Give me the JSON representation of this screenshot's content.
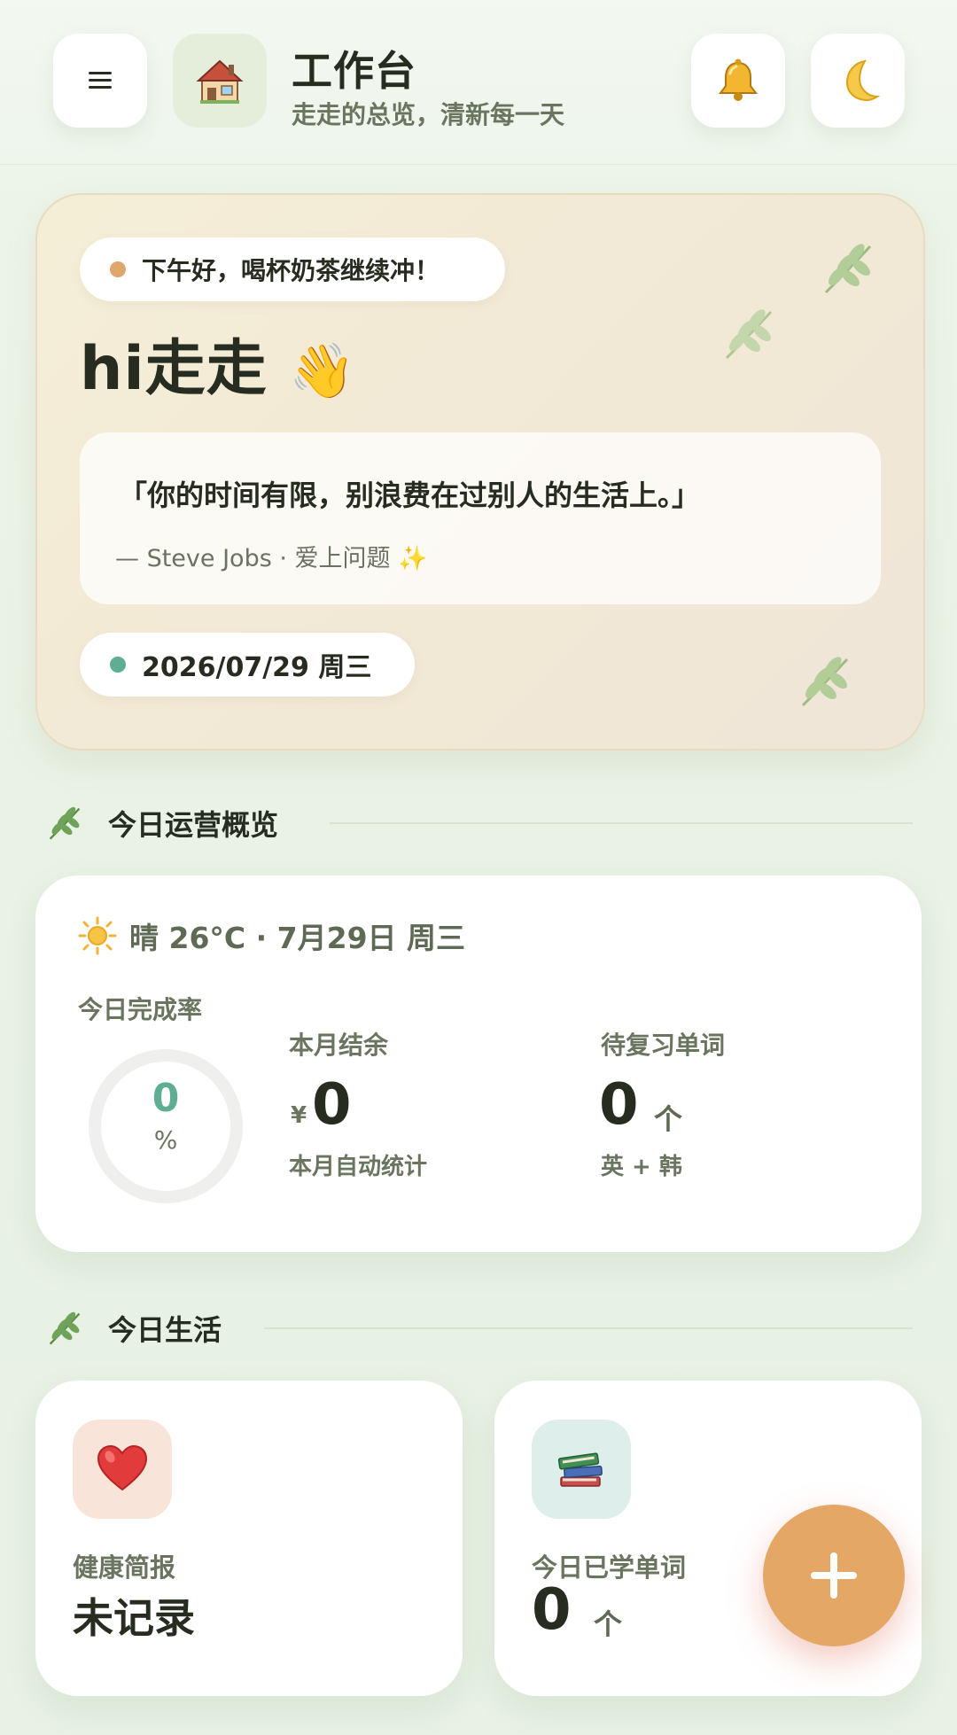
{
  "header": {
    "title": "工作台",
    "subtitle": "走走的总览，清新每一天",
    "menu_icon": "menu-icon",
    "app_icon": "house-icon",
    "notifications_icon": "bell-icon",
    "theme_icon": "moon-icon"
  },
  "hero": {
    "greeting": "下午好，喝杯奶茶继续冲！",
    "name": "hi走走",
    "wave_emoji": "👋",
    "quote": "「你的时间有限，别浪费在过别人的生活上。」",
    "quote_author": "— Steve Jobs · 爱上问题 ✨",
    "date": "2026/07/29 周三"
  },
  "sections": {
    "overview_title": "今日运营概览",
    "life_title": "今日生活"
  },
  "overview": {
    "weather": "晴 26°C · 7月29日 周三",
    "completion_label": "今日完成率",
    "completion_value": "0",
    "completion_unit": "%",
    "completion_rate": 0,
    "balance_label": "本月结余",
    "balance_currency": "¥",
    "balance_value": "0",
    "balance_note": "本月自动统计",
    "review_label": "待复习单词",
    "review_value": "0",
    "review_unit": "个",
    "review_note": "英 + 韩"
  },
  "life": {
    "health_label": "健康简报",
    "health_value": "未记录",
    "health_icon": "heart-icon",
    "words_label": "今日已学单词",
    "words_value": "0",
    "words_unit": "个",
    "words_icon": "books-icon"
  },
  "fab": {
    "icon": "plus-icon"
  },
  "colors": {
    "accent_orange": "#e5a765",
    "accent_teal": "#5fae94",
    "text_dark": "#262d20",
    "text_muted": "#6a7560"
  }
}
